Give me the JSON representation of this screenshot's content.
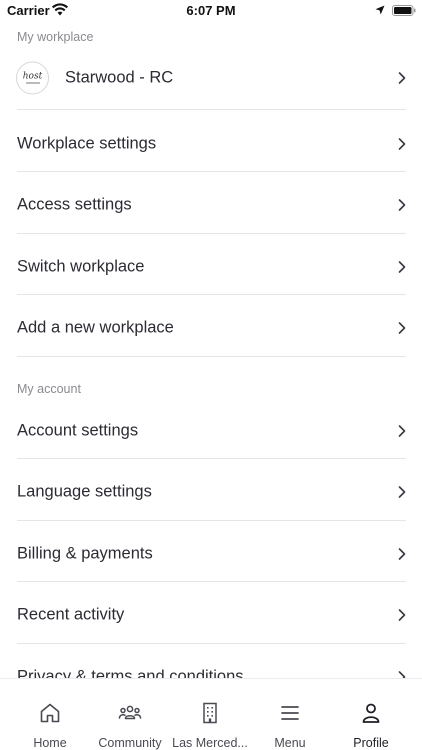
{
  "status_bar": {
    "carrier": "Carrier",
    "time": "6:07 PM"
  },
  "workplace_section": {
    "header": "My workplace",
    "current_workplace": {
      "name": "Starwood - RC",
      "logo_text": "host"
    },
    "items": [
      {
        "label": "Workplace settings"
      },
      {
        "label": "Access settings"
      },
      {
        "label": "Switch workplace"
      },
      {
        "label": "Add a new workplace"
      }
    ]
  },
  "account_section": {
    "header": "My account",
    "items": [
      {
        "label": "Account settings"
      },
      {
        "label": "Language settings"
      },
      {
        "label": "Billing & payments"
      },
      {
        "label": "Recent activity"
      },
      {
        "label": "Privacy & terms and conditions"
      }
    ]
  },
  "tab_bar": {
    "tabs": [
      {
        "label": "Home",
        "icon": "home-icon"
      },
      {
        "label": "Community",
        "icon": "community-icon"
      },
      {
        "label": "Las Merced...",
        "icon": "building-icon"
      },
      {
        "label": "Menu",
        "icon": "menu-icon"
      },
      {
        "label": "Profile",
        "icon": "profile-icon",
        "active": true
      }
    ]
  }
}
